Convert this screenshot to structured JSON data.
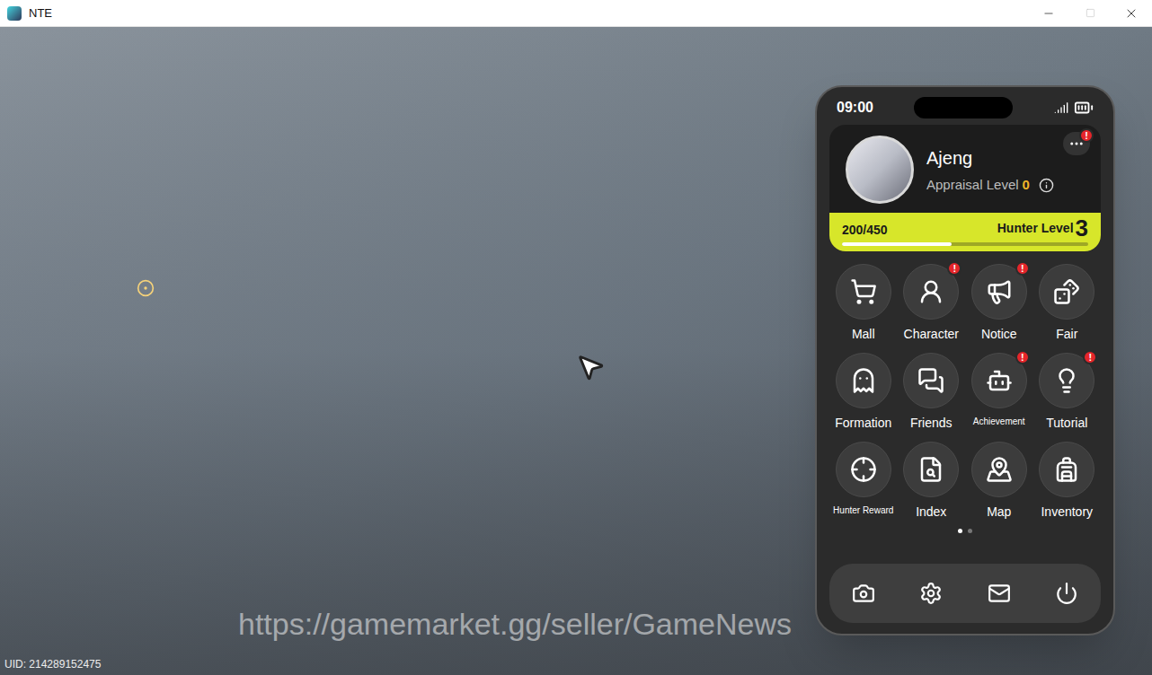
{
  "window": {
    "title": "NTE"
  },
  "scene": {
    "uid": "UID: 214289152475",
    "watermark": "https://gamemarket.gg/seller/GameNews"
  },
  "phone": {
    "time": "09:00",
    "alert_mark": "!",
    "profile": {
      "name": "Ajeng",
      "appraisal_label": "Appraisal Level",
      "appraisal_level": "0",
      "menu_alert": true,
      "xp": "200/450",
      "hunter_label": "Hunter Level",
      "hunter_level": "3",
      "level": 0.444
    },
    "apps": [
      {
        "label": "Mall",
        "alert": false
      },
      {
        "label": "Character",
        "alert": true
      },
      {
        "label": "Notice",
        "alert": true
      },
      {
        "label": "Fair",
        "alert": false
      },
      {
        "label": "Formation",
        "alert": false
      },
      {
        "label": "Friends",
        "alert": false
      },
      {
        "label": "Achievement",
        "alert": true
      },
      {
        "label": "Tutorial",
        "alert": true
      },
      {
        "label": "Hunter Reward",
        "alert": false
      },
      {
        "label": "Index",
        "alert": false
      },
      {
        "label": "Map",
        "alert": false
      },
      {
        "label": "Inventory",
        "alert": false
      }
    ],
    "pages": [
      {
        "selected": true
      },
      {
        "selected": false
      }
    ]
  }
}
